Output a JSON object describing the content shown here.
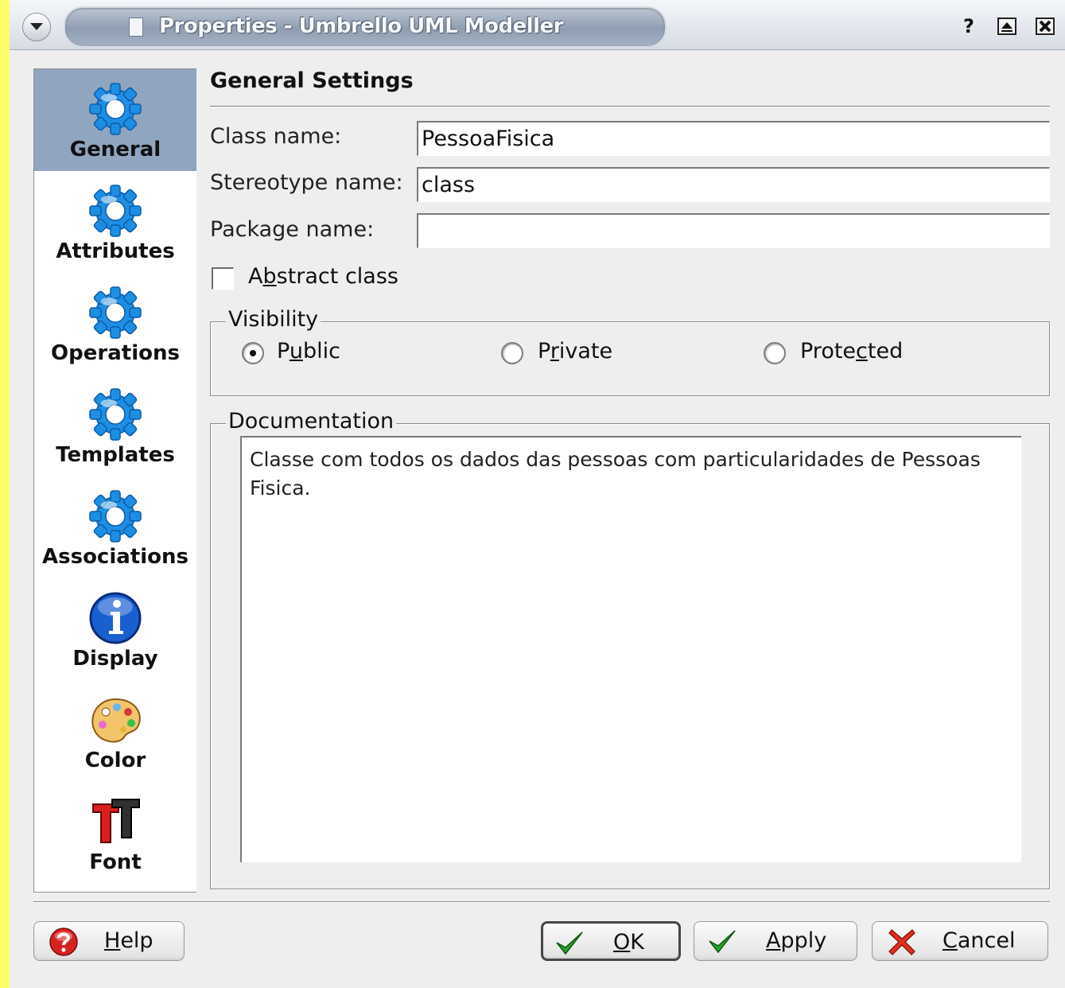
{
  "window": {
    "title": "Properties - Umbrello UML Modeller",
    "help_glyph": "?",
    "maximize_glyph": "⏏",
    "close_glyph": "X"
  },
  "sidebar": {
    "items": [
      {
        "label": "General",
        "icon": "gear-icon",
        "selected": true
      },
      {
        "label": "Attributes",
        "icon": "gear-icon"
      },
      {
        "label": "Operations",
        "icon": "gear-icon"
      },
      {
        "label": "Templates",
        "icon": "gear-icon"
      },
      {
        "label": "Associations",
        "icon": "gear-icon"
      },
      {
        "label": "Display",
        "icon": "info-icon"
      },
      {
        "label": "Color",
        "icon": "palette-icon"
      },
      {
        "label": "Font",
        "icon": "font-icon"
      }
    ]
  },
  "general": {
    "heading": "General Settings",
    "class_name_label": "Class name:",
    "class_name_value": "PessoaFisica",
    "stereotype_label": "Stereotype name:",
    "stereotype_value": "class",
    "package_label": "Package name:",
    "package_value": "",
    "abstract_label_pre": "A",
    "abstract_label_mn": "b",
    "abstract_label_post": "stract class",
    "abstract_checked": false
  },
  "visibility": {
    "title": "Visibility",
    "public_pre": "P",
    "public_mn": "u",
    "public_post": "blic",
    "private_pre": "P",
    "private_mn": "r",
    "private_post": "ivate",
    "protected_pre": "Prote",
    "protected_mn": "c",
    "protected_post": "ted",
    "selected": "Public"
  },
  "documentation": {
    "title": "Documentation",
    "text": "Classe com todos os dados das pessoas com particularidades de Pessoas Fisica."
  },
  "buttons": {
    "help_mn": "H",
    "help_rest": "elp",
    "ok_mn": "O",
    "ok_rest": "K",
    "apply_mn": "A",
    "apply_rest": "pply",
    "cancel_mn": "C",
    "cancel_rest": "ancel"
  },
  "colors": {
    "background_outside": "#fdfd6c",
    "selected_item": "#8fa5c0",
    "gear_blue": "#1e90e6"
  }
}
